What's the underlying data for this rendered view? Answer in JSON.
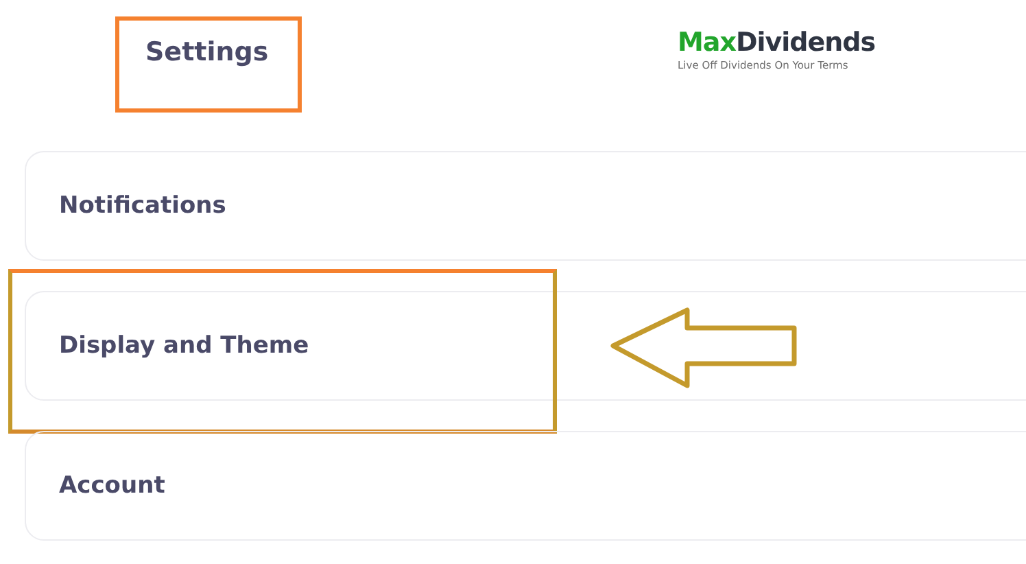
{
  "header": {
    "title": "Settings",
    "title_highlighted": true,
    "logo": {
      "brand_first": "Max",
      "brand_second": "Dividends",
      "tagline": "Live Off Dividends On Your Terms"
    }
  },
  "menu": [
    {
      "label": "Notifications",
      "highlighted": false,
      "arrow": false
    },
    {
      "label": "Display and Theme",
      "highlighted": true,
      "arrow": true
    },
    {
      "label": "Account",
      "highlighted": false,
      "arrow": false
    }
  ]
}
